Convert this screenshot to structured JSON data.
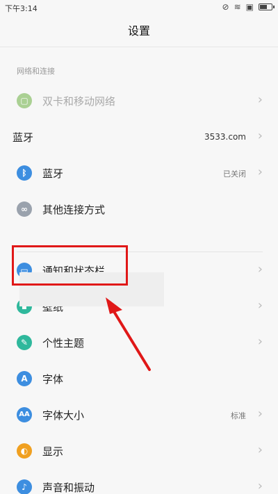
{
  "status_bar": {
    "time": "下午3:14",
    "icons": [
      "alarm-off-icon",
      "wifi-icon",
      "sim-icon",
      "battery-icon"
    ],
    "battery_level": 0.6
  },
  "header": {
    "title": "设置"
  },
  "section": {
    "network_header": "网络和连接"
  },
  "rows": [
    {
      "label": "双卡和移动网络",
      "value": "",
      "icon": "sim-card-icon",
      "icon_color": "#8ac06a",
      "dimmed": true
    },
    {
      "label": "蓝牙",
      "value": "3533.com",
      "icon": "",
      "icon_color": "",
      "dimmed": false
    },
    {
      "label": "蓝牙",
      "value": "已关闭",
      "icon": "bluetooth-icon",
      "icon_color": "#3d8ee0",
      "dimmed": false
    },
    {
      "label": "其他连接方式",
      "value": "",
      "icon": "link-icon",
      "icon_color": "#9aa2ad",
      "dimmed": false
    },
    {
      "label": "通知和状态栏",
      "value": "",
      "icon": "notification-icon",
      "icon_color": "#3d8ee0",
      "dimmed": false
    },
    {
      "label": "壁纸",
      "value": "",
      "icon": "wallpaper-icon",
      "icon_color": "#2fb89c",
      "dimmed": false
    },
    {
      "label": "个性主题",
      "value": "",
      "icon": "theme-icon",
      "icon_color": "#2fb89c",
      "dimmed": false
    },
    {
      "label": "字体",
      "value": "",
      "icon": "font-icon",
      "icon_color": "#3d8ee0",
      "dimmed": false
    },
    {
      "label": "字体大小",
      "value": "标准",
      "icon": "font-size-icon",
      "icon_color": "#3d8ee0",
      "dimmed": false
    },
    {
      "label": "显示",
      "value": "",
      "icon": "display-icon",
      "icon_color": "#f0a020",
      "dimmed": false
    },
    {
      "label": "声音和振动",
      "value": "",
      "icon": "sound-icon",
      "icon_color": "#3d8ee0",
      "dimmed": false
    }
  ],
  "colors": {
    "annotation_red": "#e01818"
  }
}
